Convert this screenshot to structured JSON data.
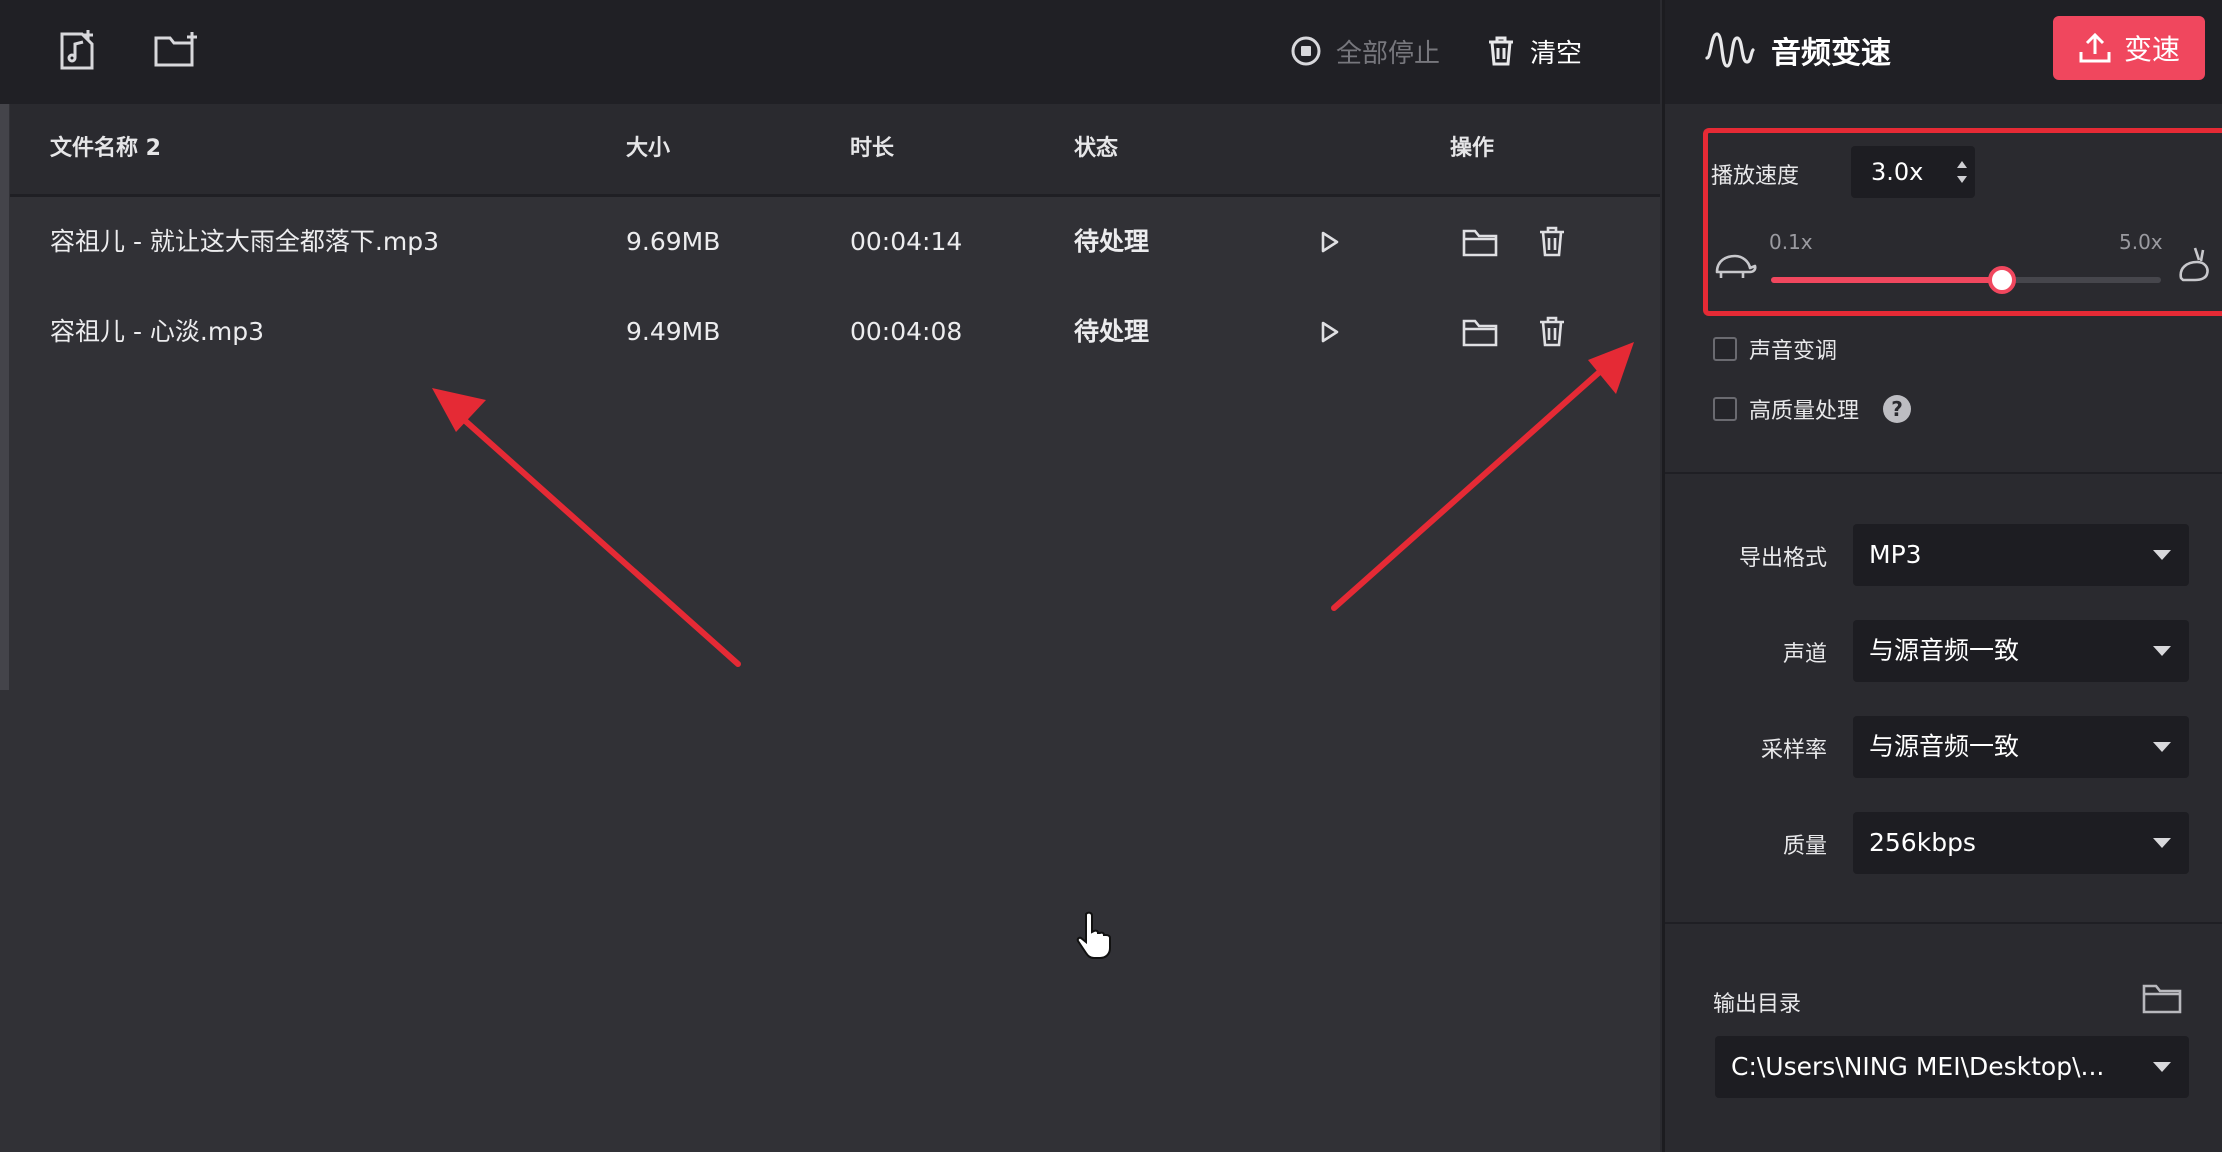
{
  "toolbar": {
    "add_file_icon": "music-file-add-icon",
    "add_folder_icon": "folder-add-icon",
    "stop_all_label": "全部停止",
    "clear_label": "清空"
  },
  "table": {
    "headers": {
      "name": "文件名称 2",
      "size": "大小",
      "duration": "时长",
      "status": "状态",
      "actions": "操作"
    },
    "rows": [
      {
        "name": "容祖儿 - 就让这大雨全都落下.mp3",
        "size": "9.69MB",
        "duration": "00:04:14",
        "status": "待处理"
      },
      {
        "name": "容祖儿 - 心淡.mp3",
        "size": "9.49MB",
        "duration": "00:04:08",
        "status": "待处理"
      }
    ]
  },
  "panel": {
    "title": "音频变速",
    "action_button": "变速",
    "speed": {
      "label": "播放速度",
      "value": "3.0x",
      "min_label": "0.1x",
      "max_label": "5.0x",
      "min": 0.1,
      "max": 5.0,
      "current": 3.0
    },
    "pitch_checkbox": {
      "label": "声音变调",
      "checked": false
    },
    "hq_checkbox": {
      "label": "高质量处理",
      "checked": false,
      "help": "?"
    },
    "format": {
      "label": "导出格式",
      "value": "MP3"
    },
    "channel": {
      "label": "声道",
      "value": "与源音频一致"
    },
    "sample_rate": {
      "label": "采样率",
      "value": "与源音频一致"
    },
    "quality": {
      "label": "质量",
      "value": "256kbps"
    },
    "output": {
      "label": "输出目录",
      "value": "C:\\Users\\NING MEI\\Desktop\\..."
    }
  },
  "colors": {
    "accent": "#f0475e",
    "annotation": "#e52a35",
    "background": "#313136",
    "panel": "#2a2a2f"
  }
}
